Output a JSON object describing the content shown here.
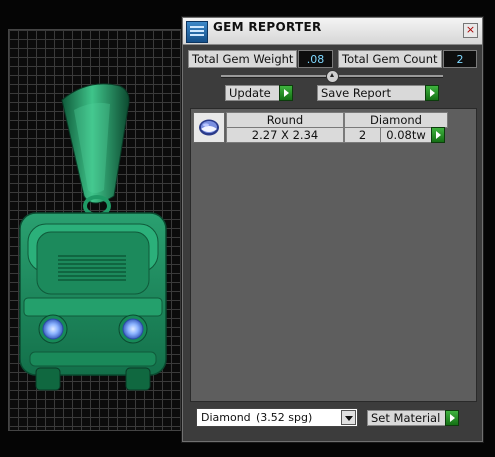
{
  "window": {
    "title": "GEM REPORTER",
    "icon": "app-icon",
    "close": "×"
  },
  "stats": {
    "total_weight_label": "Total Gem Weight",
    "total_weight_value": ".08",
    "total_count_label": "Total Gem Count",
    "total_count_value": "2"
  },
  "actions": {
    "update_label": "Update",
    "save_report_label": "Save Report",
    "set_material_label": "Set Material"
  },
  "gems": [
    {
      "shape": "Round",
      "size": "2.27 X 2.34",
      "material": "Diamond",
      "count": "2",
      "weight": "0.08tw",
      "thumbnail": "round-diamond-icon"
    }
  ],
  "material_select": {
    "value": "Diamond",
    "spg": "(3.52 spg)"
  },
  "colors": {
    "model_green": "#1f8f5f",
    "gem_blue": "#7fb4ff",
    "stat_value_text": "#7fd8ff",
    "play_green": "#2a9a2a",
    "panel_bg": "#3c3c3c",
    "list_bg": "#5e5e5e"
  }
}
